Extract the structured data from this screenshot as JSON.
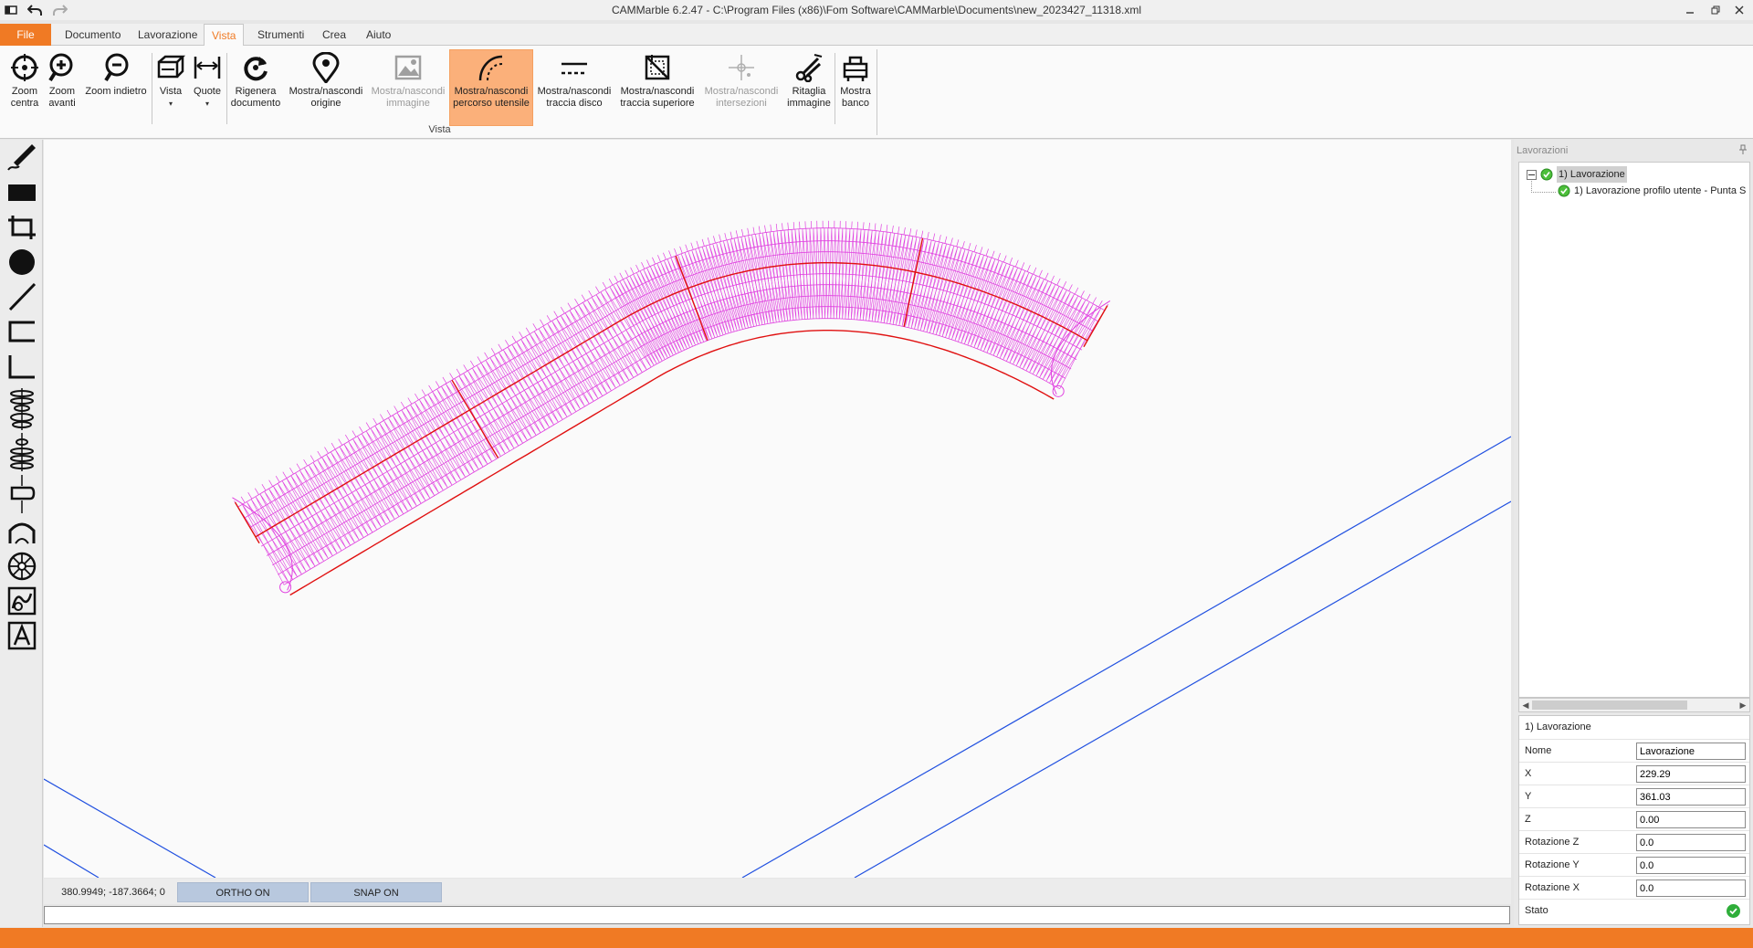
{
  "window": {
    "title": "CAMMarble 6.2.47 - C:\\Program Files (x86)\\Fom Software\\CAMMarble\\Documents\\new_2023427_11318.xml"
  },
  "tabs": [
    {
      "label": "File"
    },
    {
      "label": "Documento"
    },
    {
      "label": "Lavorazione"
    },
    {
      "label": "Vista"
    },
    {
      "label": "Strumenti"
    },
    {
      "label": "Crea"
    },
    {
      "label": "Aiuto"
    }
  ],
  "ribbon": {
    "group_label": "Vista",
    "buttons": [
      {
        "label1": "Zoom",
        "label2": "centra"
      },
      {
        "label1": "Zoom",
        "label2": "avanti"
      },
      {
        "label1": "Zoom indietro",
        "label2": ""
      },
      {
        "label1": "Vista",
        "label2": ""
      },
      {
        "label1": "Quote",
        "label2": ""
      },
      {
        "label1": "Rigenera",
        "label2": "documento"
      },
      {
        "label1": "Mostra/nascondi",
        "label2": "origine"
      },
      {
        "label1": "Mostra/nascondi",
        "label2": "immagine"
      },
      {
        "label1": "Mostra/nascondi",
        "label2": "percorso utensile"
      },
      {
        "label1": "Mostra/nascondi",
        "label2": "traccia disco"
      },
      {
        "label1": "Mostra/nascondi",
        "label2": "traccia superiore"
      },
      {
        "label1": "Mostra/nascondi",
        "label2": "intersezioni"
      },
      {
        "label1": "Ritaglia",
        "label2": "immagine"
      },
      {
        "label1": "Mostra",
        "label2": "banco"
      }
    ],
    "dropdown_glyph": "▾"
  },
  "status": {
    "coords": "380.9949; -187.3664; 0",
    "ortho": "ORTHO ON",
    "snap": "SNAP ON"
  },
  "panel": {
    "title": "Lavorazioni",
    "tree": [
      {
        "label": "1) Lavorazione"
      },
      {
        "label": "1) Lavorazione profilo utente - Punta S"
      }
    ],
    "props_title": "1) Lavorazione",
    "props": [
      {
        "label": "Nome",
        "value": "Lavorazione"
      },
      {
        "label": "X",
        "value": "229.29"
      },
      {
        "label": "Y",
        "value": "361.03"
      },
      {
        "label": "Z",
        "value": "0.00"
      },
      {
        "label": "Rotazione Z",
        "value": "0.0"
      },
      {
        "label": "Rotazione Y",
        "value": "0.0"
      },
      {
        "label": "Rotazione X",
        "value": "0.0"
      }
    ],
    "stato_label": "Stato"
  },
  "colors": {
    "accent": "#f07a24",
    "toolpath": "#e040e0",
    "profile": "#e01010",
    "bench": "#2050e0",
    "status_ok": "#2fae3a"
  },
  "icons": {
    "app": "app-icon",
    "undo": "undo-icon",
    "redo": "redo-icon",
    "minimize": "minimize-icon",
    "restore": "restore-icon",
    "close": "close-icon",
    "pin": "pin-icon"
  }
}
